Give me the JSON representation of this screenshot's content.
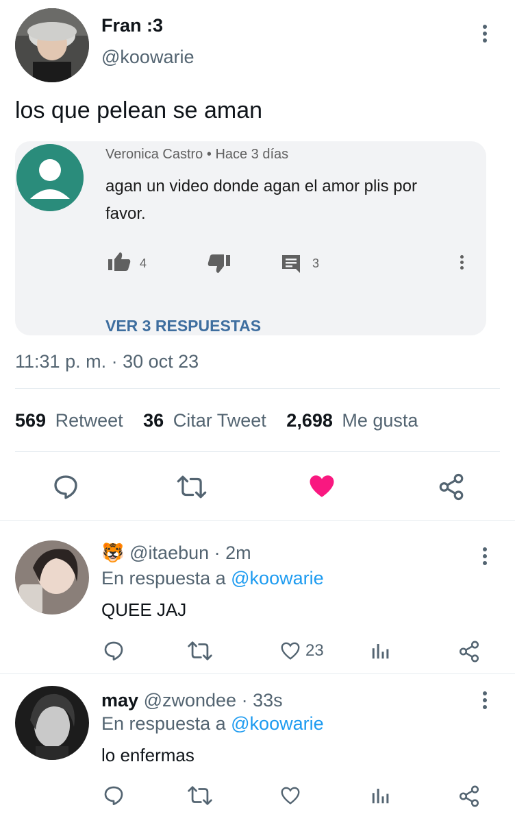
{
  "tweet": {
    "author": {
      "name": "Fran :3",
      "handle": "@koowarie"
    },
    "text": "los que pelean se aman",
    "timestamp": "11:31 p. m. · 30 oct 23",
    "stats": {
      "retweets": "569",
      "retweets_label": "Retweet",
      "quotes": "36",
      "quotes_label": "Citar Tweet",
      "likes": "2,698",
      "likes_label": "Me gusta"
    },
    "embedded_comment": {
      "author": "Veronica Castro",
      "separator": "•",
      "time": "Hace 3 días",
      "text": "agan un video donde agan el amor plis por favor.",
      "likes": "4",
      "replies": "3",
      "view_replies": "VER 3 RESPUESTAS"
    },
    "liked": true,
    "colors": {
      "like": "#f91880",
      "link": "#1d9bf0",
      "muted": "#536471"
    }
  },
  "replies": [
    {
      "emoji": "🐯",
      "name": "",
      "handle": "@itaebun",
      "time": "· 2m",
      "reply_to_prefix": "En respuesta a",
      "reply_to": "@koowarie",
      "text": "QUEE JAJ",
      "likes": "23"
    },
    {
      "emoji": "",
      "name": "may",
      "handle": "@zwondee",
      "time": "· 33s",
      "reply_to_prefix": "En respuesta a",
      "reply_to": "@koowarie",
      "text": "lo enfermas",
      "likes": ""
    }
  ]
}
